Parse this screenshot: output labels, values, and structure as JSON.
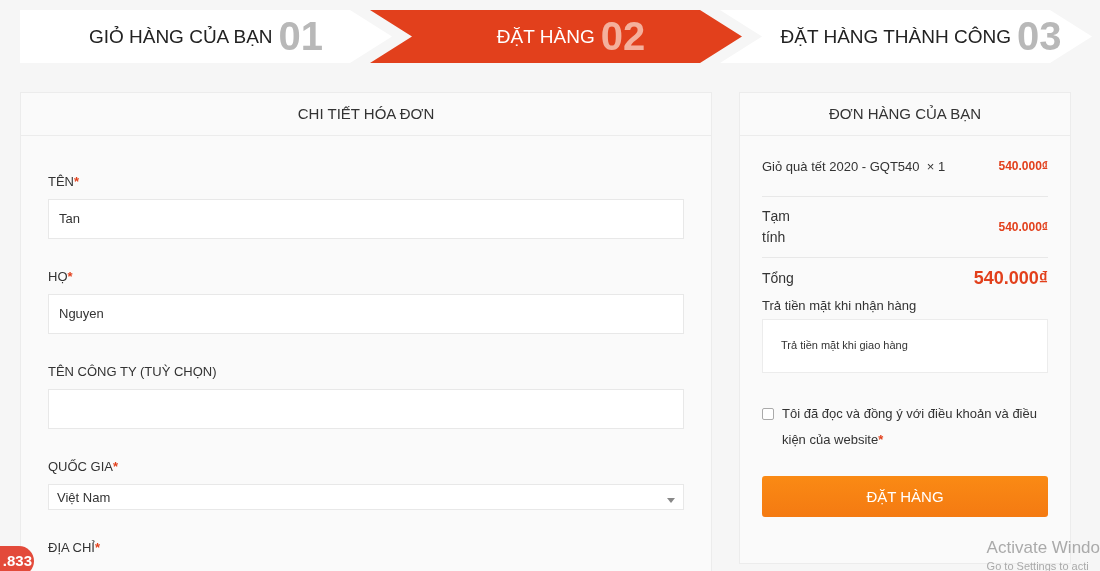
{
  "steps": [
    {
      "label": "GIỎ HÀNG CỦA BẠN",
      "number": "01",
      "selected": false
    },
    {
      "label": "ĐẶT HÀNG",
      "number": "02",
      "selected": true
    },
    {
      "label": "ĐẶT HÀNG THÀNH CÔNG",
      "number": "03",
      "selected": false
    }
  ],
  "billing": {
    "title": "CHI TIẾT HÓA ĐƠN",
    "fields": [
      {
        "kind": "text",
        "label": "TÊN",
        "required_mark": "*",
        "value": "Tan"
      },
      {
        "kind": "text",
        "label": "HỌ",
        "required_mark": "*",
        "value": "Nguyen"
      },
      {
        "kind": "text",
        "label": "TÊN CÔNG TY (TUỲ CHỌN)"
      },
      {
        "kind": "select",
        "label": "QUỐC GIA",
        "required_mark": "*",
        "value": "Việt Nam"
      },
      {
        "kind": "label_only",
        "label": "ĐỊA CHỈ",
        "required_mark": "*"
      }
    ]
  },
  "order": {
    "title": "ĐƠN HÀNG CỦA BẠN",
    "items": [
      {
        "name": "Giỏ quà tết 2020 - GQT540",
        "quantity": "× 1",
        "price": "540.000₫"
      }
    ],
    "subtotal": {
      "label": "Tạm tính",
      "value": "540.000₫"
    },
    "total": {
      "label": "Tổng",
      "value": "540.000₫"
    },
    "payment": {
      "label": "Trả tiền mặt khi nhận hàng",
      "description": "Trả tiền mặt khi giao hàng"
    },
    "terms": {
      "text": "Tôi đã đọc và đồng ý với điều khoản và điều kiện của website",
      "required_mark": "*",
      "checked": false
    },
    "button": "ĐẶT HÀNG"
  },
  "badge": ".833",
  "os_notice": [
    "Activate Windo",
    "Go to Settings to acti"
  ]
}
